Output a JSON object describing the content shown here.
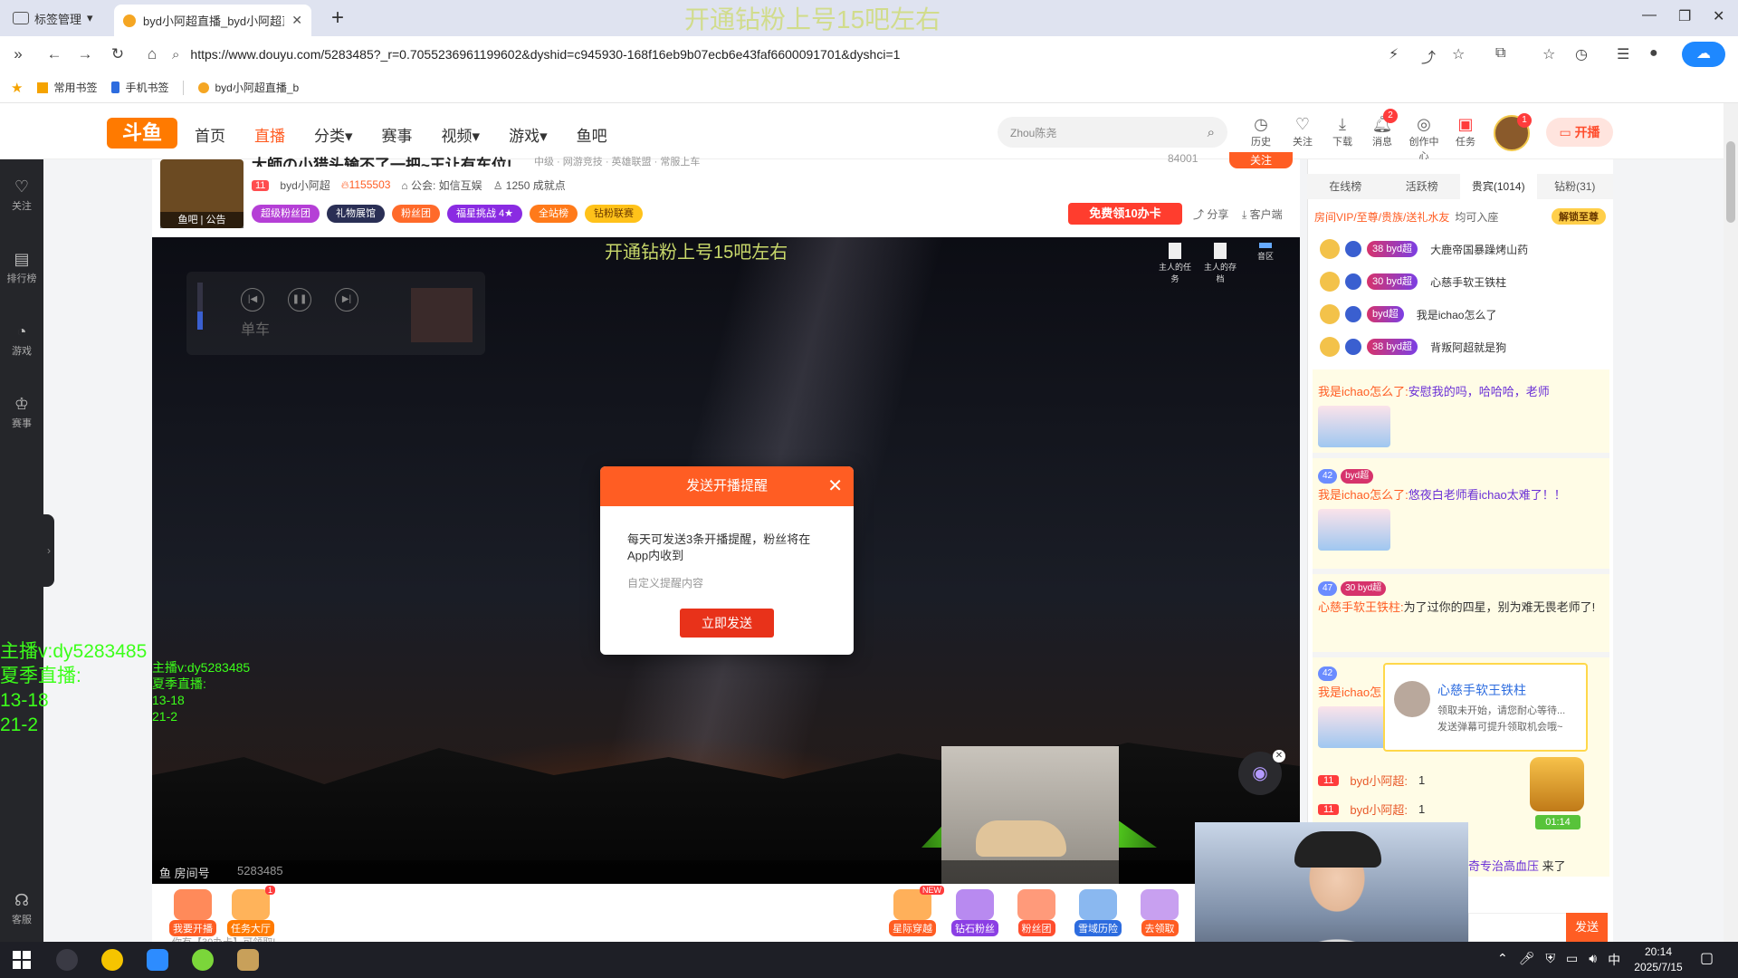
{
  "browser": {
    "tab_group_label": "标签管理",
    "tab_title": "byd小阿超直播_byd小阿超直",
    "new_tab": "+",
    "overlay_top": "开通钻粉上号15吧左右",
    "url": "https://www.douyu.com/5283485?_r=0.7055236961199602&dyshid=c945930-168f16eb9b07ecb6e43faf6600091701&dyshci=1",
    "bookmarks": [
      "常用书签",
      "手机书签",
      "byd小阿超直播_b"
    ]
  },
  "header": {
    "logo": "斗鱼",
    "nav": [
      "首页",
      "直播",
      "分类",
      "赛事",
      "视频",
      "游戏",
      "鱼吧"
    ],
    "active_nav": "直播",
    "search_placeholder": "Zhou陈尧",
    "icons": [
      {
        "label": "历史",
        "icon": "clock-icon",
        "badge": ""
      },
      {
        "label": "关注",
        "icon": "heart-icon",
        "badge": ""
      },
      {
        "label": "下载",
        "icon": "download-icon",
        "badge": ""
      },
      {
        "label": "消息",
        "icon": "bell-icon",
        "badge": "2"
      },
      {
        "label": "创作中心",
        "icon": "bulb-icon",
        "badge": ""
      },
      {
        "label": "任务",
        "icon": "gift-icon",
        "badge": ""
      }
    ],
    "avatar_badge": "1",
    "kaibo": "开播"
  },
  "leftbar": [
    {
      "label": "关注",
      "icon": "heart-icon"
    },
    {
      "label": "排行榜",
      "icon": "rank-icon"
    },
    {
      "label": "游戏",
      "icon": "gamepad-icon"
    },
    {
      "label": "赛事",
      "icon": "trophy-icon"
    },
    {
      "label": "客服",
      "icon": "headset-icon"
    }
  ],
  "room": {
    "title": "大師の小猎头输不了一把~王让有车位!",
    "tags": "中级 · 网游竞技 · 英雄联盟 · 常服上车",
    "follow_count": "84001",
    "follow_label": "关注",
    "yuba": "鱼吧",
    "notice": "公告",
    "level": "11",
    "anchor": "byd小阿超",
    "hot": "1155503",
    "guild": "公会: 如信互娱",
    "achievement": "1250 成就点",
    "chips": [
      "超级粉丝团",
      "礼物展馆",
      "粉丝团",
      "福星挑战 4★",
      "全站榜",
      "钻粉联赛"
    ],
    "free_card": "免费领10办卡",
    "share": "分享",
    "client": "客户端"
  },
  "video": {
    "overlay_title": "开通钻粉上号15吧左右",
    "player_title": "单车",
    "top_icons": [
      "主人的任务",
      "主人的存档",
      "音区"
    ],
    "room_no_label": "鱼 房间号",
    "room_id": "5283485"
  },
  "overlay_left": {
    "big": "主播v:dy5283485\n夏季直播:\n13-18\n21-2",
    "small": "主播v:dy5283485\n夏季直播:\n13-18\n21-2"
  },
  "modal": {
    "title": "发送开播提醒",
    "body": "每天可发送3条开播提醒，粉丝将在App内收到",
    "placeholder": "自定义提醒内容",
    "button": "立即发送"
  },
  "giftbar": {
    "left": [
      {
        "label": "我要开播",
        "color": "#ff5d23"
      },
      {
        "label": "任务大厅",
        "color": "#ff7a00",
        "badge": "1"
      }
    ],
    "right": [
      {
        "label": "星际穿越",
        "color": "#ff5d23",
        "new": "NEW"
      },
      {
        "label": "钻石粉丝",
        "color": "#8b3fe4"
      },
      {
        "label": "粉丝团",
        "color": "#ff4d2d"
      },
      {
        "label": "雪域历险",
        "color": "#2d6cdf"
      },
      {
        "label": "去领取",
        "color": "#ff5d23"
      }
    ],
    "notice": "你有【30办卡】可领取!"
  },
  "right_panel": {
    "tabs": [
      "在线榜",
      "活跃榜",
      "贵宾(1014)",
      "钻粉(31)"
    ],
    "active_tab": "贵宾(1014)",
    "vip_text": "房间VIP/至尊/贵族/送礼水友",
    "vip_text2": "均可入座",
    "unlock": "解锁至尊",
    "noble": [
      {
        "lv": "38",
        "fan": "byd超",
        "name": "大鹿帝国暴躁烤山药"
      },
      {
        "lv": "30",
        "fan": "byd超",
        "name": "心慈手软王铁柱"
      },
      {
        "lv": "",
        "fan": "byd超",
        "name": "我是ichao怎么了"
      },
      {
        "lv": "38",
        "fan": "byd超",
        "name": "背叛阿超就是狗"
      }
    ],
    "chat": [
      {
        "nick": "我是ichao怎么了:",
        "text": "安慰我的吗，哈哈哈，老师",
        "emote": true
      },
      {
        "badge": "42",
        "nick": "我是ichao怎么了:",
        "text": "悠夜白老师看ichao太难了！！",
        "emote": true
      },
      {
        "badge": "47",
        "nick": "心慈手软王铁柱:",
        "text": "为了过你的四星，别为难无畏老师了!",
        "emote": false
      },
      {
        "badge": "42",
        "nick": "我是ichao怎",
        "text": "",
        "emote": true
      }
    ],
    "popup": {
      "name": "心慈手软王铁柱",
      "line1": "领取未开始，请您耐心等待...",
      "line2": "发送弹幕可提升领取机会哦~"
    },
    "sys": [
      {
        "lv": "11",
        "name": "byd小阿超:",
        "count": "1"
      },
      {
        "lv": "11",
        "name": "byd小阿超:",
        "count": "1"
      }
    ],
    "chest_time": "01:14",
    "came": {
      "name": "奇专治高血压",
      "suffix": "来了"
    },
    "send": "发送"
  },
  "taskbar": {
    "time": "20:14",
    "date": "2025/7/15",
    "ime": "中"
  }
}
